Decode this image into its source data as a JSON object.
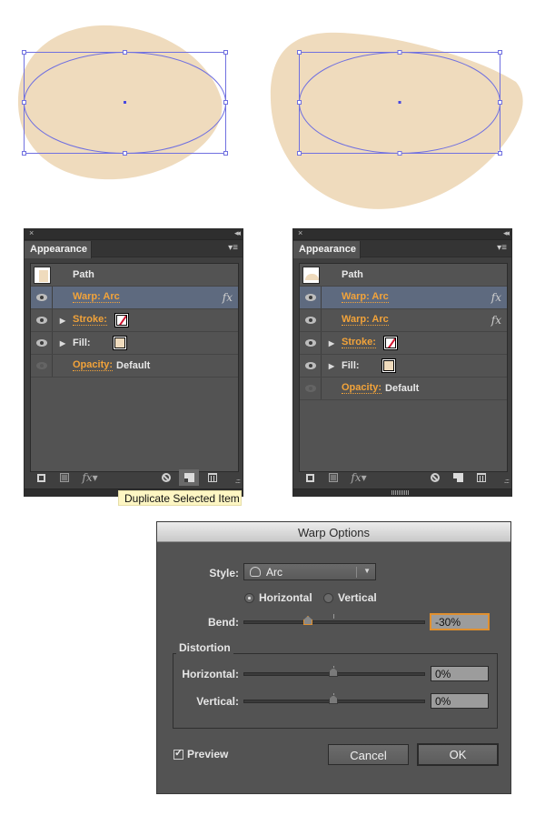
{
  "artboard": {
    "fill_color": "#efdbbd",
    "selection_color": "#7070e0",
    "shapes": [
      {
        "name": "shape-single-warp",
        "description": "Ellipse warped with one Arc warp"
      },
      {
        "name": "shape-double-warp",
        "description": "Ellipse warped with two Arc warps"
      }
    ]
  },
  "panels": [
    {
      "close_icon": "×",
      "collapse_icon": "◂◂",
      "tab_label": "Appearance",
      "menu_icon": "▾≡",
      "path_label": "Path",
      "rows": [
        {
          "type": "effect",
          "label": "Warp: Arc",
          "fx": "fx",
          "selected": true,
          "visible": true
        },
        {
          "type": "stroke",
          "label": "Stroke:",
          "link": true,
          "visible": true
        },
        {
          "type": "fill",
          "label": "Fill:",
          "link": false,
          "visible": true
        },
        {
          "type": "opacity",
          "label": "Opacity:",
          "value": "Default",
          "visible": false
        }
      ],
      "footer": {
        "add_stroke": "add-new-stroke",
        "add_fill": "add-new-fill",
        "fx_menu": "fx▾",
        "clear": "clear-appearance",
        "duplicate": "duplicate-selected-item",
        "delete": "delete-selected-item"
      },
      "tooltip": "Duplicate Selected Item"
    },
    {
      "close_icon": "×",
      "collapse_icon": "◂◂",
      "tab_label": "Appearance",
      "menu_icon": "▾≡",
      "path_label": "Path",
      "rows": [
        {
          "type": "effect",
          "label": "Warp: Arc",
          "fx": "fx",
          "selected": true,
          "visible": true
        },
        {
          "type": "effect",
          "label": "Warp: Arc",
          "fx": "fx",
          "selected": false,
          "visible": true
        },
        {
          "type": "stroke",
          "label": "Stroke:",
          "link": true,
          "visible": true
        },
        {
          "type": "fill",
          "label": "Fill:",
          "link": false,
          "visible": true
        },
        {
          "type": "opacity",
          "label": "Opacity:",
          "value": "Default",
          "visible": false
        }
      ],
      "footer": {
        "add_stroke": "add-new-stroke",
        "add_fill": "add-new-fill",
        "fx_menu": "fx▾",
        "clear": "clear-appearance",
        "duplicate": "duplicate-selected-item",
        "delete": "delete-selected-item"
      }
    }
  ],
  "dialog": {
    "title": "Warp Options",
    "style_label": "Style:",
    "style_value": "Arc",
    "orientation": {
      "horizontal_label": "Horizontal",
      "vertical_label": "Vertical",
      "selected": "Horizontal"
    },
    "bend": {
      "label": "Bend:",
      "value": "-30%",
      "percent": -30
    },
    "distortion": {
      "group_label": "Distortion",
      "horizontal": {
        "label": "Horizontal:",
        "value": "0%",
        "percent": 0
      },
      "vertical": {
        "label": "Vertical:",
        "value": "0%",
        "percent": 0
      }
    },
    "preview": {
      "label": "Preview",
      "checked": true
    },
    "cancel_label": "Cancel",
    "ok_label": "OK",
    "accent_color": "#e0902f"
  }
}
